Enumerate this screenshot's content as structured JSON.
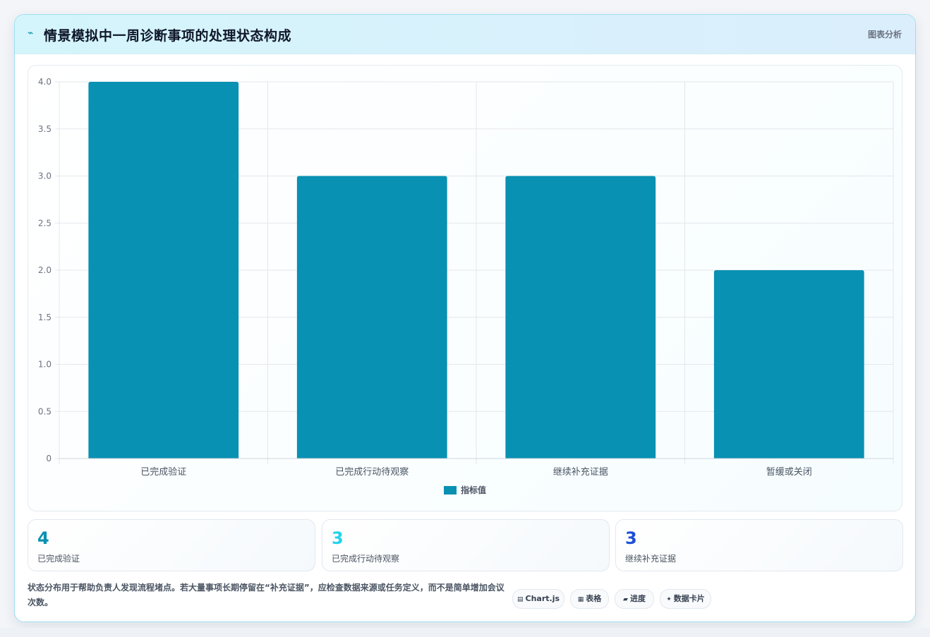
{
  "header": {
    "icon": "spark-icon",
    "title": "情景模拟中一周诊断事项的处理状态构成",
    "tag": "图表分析"
  },
  "chart_data": {
    "type": "bar",
    "categories": [
      "已完成验证",
      "已完成行动待观察",
      "继续补充证据",
      "暂缓或关闭"
    ],
    "series": [
      {
        "name": "指标值",
        "values": [
          4,
          3,
          3,
          2
        ],
        "color": "#0891b2"
      }
    ],
    "ylim": [
      0,
      4
    ],
    "yticks": [
      0,
      0.5,
      1.0,
      1.5,
      2.0,
      2.5,
      3.0,
      3.5,
      4.0
    ],
    "ytick_labels": [
      "0",
      "0.5",
      "1.0",
      "1.5",
      "2.0",
      "2.5",
      "3.0",
      "3.5",
      "4.0"
    ],
    "grid": true,
    "legend": "bottom"
  },
  "stats": [
    {
      "value": "4",
      "label": "已完成验证",
      "color": "#0891b2"
    },
    {
      "value": "3",
      "label": "已完成行动待观察",
      "color": "#22d3ee"
    },
    {
      "value": "3",
      "label": "继续补充证据",
      "color": "#1d4ed8"
    }
  ],
  "footer": {
    "note": "状态分布用于帮助负责人发现流程堵点。若大量事项长期停留在“补充证据”，应检查数据来源或任务定义，而不是简单增加会议次数。",
    "badges": [
      {
        "icon": "chart-icon",
        "glyph": "▤",
        "label": "Chart.js"
      },
      {
        "icon": "table-icon",
        "glyph": "▦",
        "label": "表格"
      },
      {
        "icon": "progress-icon",
        "glyph": "▰",
        "label": "进度"
      },
      {
        "icon": "sparkle-icon",
        "glyph": "✦",
        "label": "数据卡片"
      }
    ]
  }
}
